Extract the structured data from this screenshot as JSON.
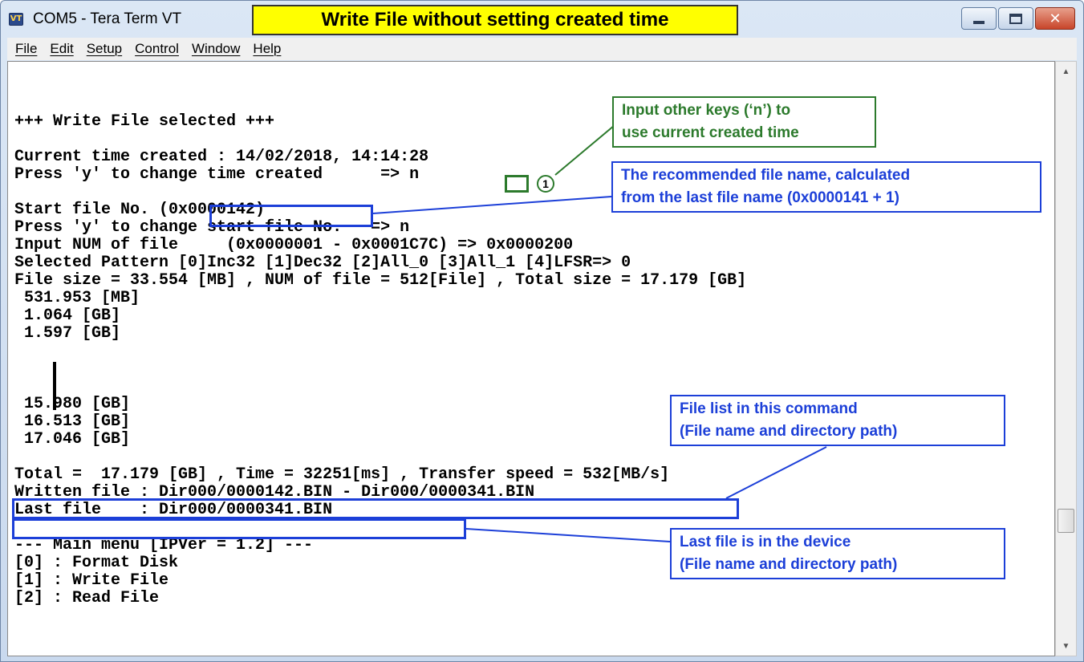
{
  "window": {
    "title": "COM5 - Tera Term VT",
    "icon_label": "VT",
    "buttons": [
      "minimize",
      "maximize",
      "close"
    ]
  },
  "menu": {
    "items": [
      "File",
      "Edit",
      "Setup",
      "Control",
      "Window",
      "Help"
    ]
  },
  "terminal": {
    "lines": [
      "",
      "+++ Write File selected +++",
      "",
      "Current time created : 14/02/2018, 14:14:28",
      "Press 'y' to change time created      => n",
      "",
      "Start file No. (0x0000142)",
      "Press 'y' to change start file No.   => n",
      "Input NUM of file     (0x0000001 - 0x0001C7C) => 0x0000200",
      "Selected Pattern [0]Inc32 [1]Dec32 [2]All_0 [3]All_1 [4]LFSR=> 0",
      "File size = 33.554 [MB] , NUM of file = 512[File] , Total size = 17.179 [GB]",
      " 531.953 [MB]",
      " 1.064 [GB]",
      " 1.597 [GB]",
      "",
      "",
      "",
      " 15.980 [GB]",
      " 16.513 [GB]",
      " 17.046 [GB]",
      "",
      "Total =  17.179 [GB] , Time = 32251[ms] , Transfer speed = 532[MB/s]",
      "Written file : Dir000/0000142.BIN - Dir000/0000341.BIN",
      "Last file    : Dir000/0000341.BIN",
      "",
      "--- Main menu [IPVer = 1.2] ---",
      "[0] : Format Disk",
      "[1] : Write File",
      "[2] : Read File"
    ]
  },
  "annotations": {
    "banner": "Write File without setting created time",
    "callout_keys_line1": "Input other keys (‘n’) to",
    "callout_keys_line2": "use current created time",
    "callout_name_line1": "The recommended file name, calculated",
    "callout_name_line2": "from the last file name (0x0000141 + 1)",
    "callout_list_line1": "File list in this command",
    "callout_list_line2": "(File name and directory path)",
    "callout_last_line1": "Last file is in the device",
    "callout_last_line2": "(File name and directory path)",
    "step_marker": "1"
  },
  "colors": {
    "banner_bg": "#ffff00",
    "callout_green": "#2c7a2c",
    "callout_blue": "#1c3fd8"
  }
}
